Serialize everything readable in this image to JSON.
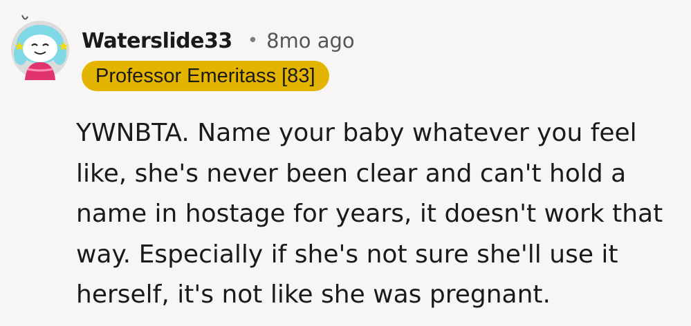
{
  "comment": {
    "username": "Waterslide33",
    "separator": "•",
    "timestamp": "8mo ago",
    "flair": {
      "text": "Professor Emeritass [83]",
      "background": "#e3b500"
    },
    "avatar": {
      "icon": "snoo-avatar-icon"
    },
    "body_lines": [
      "YWNBTA. Name your baby whatever you feel",
      "like, she's never been clear and can't hold a",
      "name in hostage for years, it doesn't work that",
      "way. Especially if she's not sure she'll use it",
      "herself, it's not like she was pregnant."
    ]
  }
}
